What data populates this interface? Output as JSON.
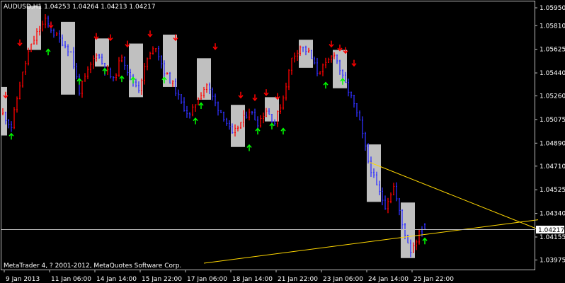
{
  "window": {
    "header": "AUDUSD,H1  1.04253 1.04264 1.04213 1.04217",
    "footer": "MetaTrader 4, ? 2001-2012, MetaQuotes Software Corp."
  },
  "colors": {
    "background": "#000000",
    "axis": "#c0c0c0",
    "bull": "#ff0000",
    "bear": "#3030ff",
    "box": "#c0c0c0",
    "arrow_up": "#00ff00",
    "arrow_down": "#ff0000",
    "trendline": "#ffd700",
    "price_line": "#c0c0c0"
  },
  "chart_data": {
    "type": "candlestick",
    "symbol": "AUDUSD",
    "timeframe": "H1",
    "ohlc": {
      "open": 1.04253,
      "high": 1.04264,
      "low": 1.04213,
      "close": 1.04217
    },
    "current_price": 1.04217,
    "ylim": [
      1.039,
      1.06
    ],
    "yticks": [
      1.0595,
      1.0581,
      1.05625,
      1.0544,
      1.0526,
      1.05075,
      1.0489,
      1.0471,
      1.04525,
      1.0434,
      1.04155,
      1.03975
    ],
    "ytick_labels": [
      "1.05950",
      "1.05810",
      "1.05625",
      "1.05440",
      "1.05260",
      "1.05075",
      "1.04890",
      "1.04710",
      "1.04525",
      "1.04340",
      "1.04155",
      "1.03975"
    ],
    "xlabels": [
      "9 Jan 2013",
      "11 Jan 06:00",
      "14 Jan 14:00",
      "15 Jan 22:00",
      "17 Jan 06:00",
      "18 Jan 14:00",
      "21 Jan 22:00",
      "23 Jan 06:00",
      "24 Jan 14:00",
      "25 Jan 22:00"
    ],
    "bar_count": 150,
    "close_path": [
      [
        0,
        1.0512
      ],
      [
        3,
        1.0502
      ],
      [
        6,
        1.0535
      ],
      [
        9,
        1.056
      ],
      [
        12,
        1.0575
      ],
      [
        15,
        1.0585
      ],
      [
        18,
        1.0575
      ],
      [
        21,
        1.0568
      ],
      [
        24,
        1.056
      ],
      [
        27,
        1.053
      ],
      [
        30,
        1.0545
      ],
      [
        33,
        1.056
      ],
      [
        36,
        1.0548
      ],
      [
        39,
        1.0538
      ],
      [
        42,
        1.0558
      ],
      [
        45,
        1.054
      ],
      [
        48,
        1.0532
      ],
      [
        51,
        1.0555
      ],
      [
        54,
        1.0565
      ],
      [
        57,
        1.0545
      ],
      [
        60,
        1.0535
      ],
      [
        63,
        1.052
      ],
      [
        66,
        1.051
      ],
      [
        69,
        1.0525
      ],
      [
        72,
        1.0535
      ],
      [
        75,
        1.052
      ],
      [
        78,
        1.051
      ],
      [
        81,
        1.0495
      ],
      [
        84,
        1.0505
      ],
      [
        87,
        1.0515
      ],
      [
        90,
        1.0505
      ],
      [
        93,
        1.0515
      ],
      [
        96,
        1.0505
      ],
      [
        99,
        1.0525
      ],
      [
        102,
        1.0555
      ],
      [
        105,
        1.0565
      ],
      [
        108,
        1.056
      ],
      [
        111,
        1.0545
      ],
      [
        114,
        1.055
      ],
      [
        117,
        1.056
      ],
      [
        120,
        1.054
      ],
      [
        123,
        1.0525
      ],
      [
        126,
        1.0505
      ],
      [
        129,
        1.0475
      ],
      [
        132,
        1.0455
      ],
      [
        135,
        1.044
      ],
      [
        138,
        1.0455
      ],
      [
        141,
        1.0425
      ],
      [
        144,
        1.0405
      ],
      [
        147,
        1.0418
      ],
      [
        149,
        1.04217
      ]
    ],
    "boxes": [
      {
        "bars": [
          -1,
          1
        ],
        "high": 1.0533,
        "low": 1.0495
      },
      {
        "bars": [
          9,
          13
        ],
        "high": 1.05965,
        "low": 1.0562
      },
      {
        "bars": [
          21,
          25
        ],
        "high": 1.0584,
        "low": 1.0527
      },
      {
        "bars": [
          33,
          37
        ],
        "high": 1.0571,
        "low": 1.0549
      },
      {
        "bars": [
          45,
          49
        ],
        "high": 1.0567,
        "low": 1.0525
      },
      {
        "bars": [
          57,
          61
        ],
        "high": 1.0574,
        "low": 1.0533
      },
      {
        "bars": [
          69,
          73
        ],
        "high": 1.05555,
        "low": 1.0523
      },
      {
        "bars": [
          81,
          85
        ],
        "high": 1.0519,
        "low": 1.0486
      },
      {
        "bars": [
          93,
          97
        ],
        "high": 1.0525,
        "low": 1.0506
      },
      {
        "bars": [
          105,
          109
        ],
        "high": 1.057,
        "low": 1.0548
      },
      {
        "bars": [
          117,
          121
        ],
        "high": 1.0562,
        "low": 1.0532
      },
      {
        "bars": [
          129,
          133
        ],
        "high": 1.0488,
        "low": 1.0443
      },
      {
        "bars": [
          141,
          145
        ],
        "high": 1.04425,
        "low": 1.0399
      }
    ],
    "arrows": [
      {
        "bar": 1,
        "price": 1.0527,
        "dir": "down"
      },
      {
        "bar": 3,
        "price": 1.0494,
        "dir": "up"
      },
      {
        "bar": 6,
        "price": 1.0568,
        "dir": "down"
      },
      {
        "bar": 16,
        "price": 1.056,
        "dir": "up"
      },
      {
        "bar": 17,
        "price": 1.0582,
        "dir": "down"
      },
      {
        "bar": 27,
        "price": 1.0537,
        "dir": "up"
      },
      {
        "bar": 33,
        "price": 1.0573,
        "dir": "down"
      },
      {
        "bar": 36,
        "price": 1.0545,
        "dir": "up"
      },
      {
        "bar": 38,
        "price": 1.0572,
        "dir": "down"
      },
      {
        "bar": 42,
        "price": 1.0539,
        "dir": "up"
      },
      {
        "bar": 44,
        "price": 1.0567,
        "dir": "down"
      },
      {
        "bar": 46,
        "price": 1.0538,
        "dir": "up"
      },
      {
        "bar": 52,
        "price": 1.0575,
        "dir": "down"
      },
      {
        "bar": 57,
        "price": 1.0538,
        "dir": "up"
      },
      {
        "bar": 61,
        "price": 1.0572,
        "dir": "down"
      },
      {
        "bar": 68,
        "price": 1.0506,
        "dir": "up"
      },
      {
        "bar": 70,
        "price": 1.0518,
        "dir": "up"
      },
      {
        "bar": 75,
        "price": 1.0565,
        "dir": "down"
      },
      {
        "bar": 84,
        "price": 1.0527,
        "dir": "down"
      },
      {
        "bar": 87,
        "price": 1.0485,
        "dir": "up"
      },
      {
        "bar": 89,
        "price": 1.0525,
        "dir": "down"
      },
      {
        "bar": 90,
        "price": 1.0498,
        "dir": "up"
      },
      {
        "bar": 93,
        "price": 1.0529,
        "dir": "down"
      },
      {
        "bar": 95,
        "price": 1.0502,
        "dir": "up"
      },
      {
        "bar": 97,
        "price": 1.0526,
        "dir": "down"
      },
      {
        "bar": 99,
        "price": 1.0498,
        "dir": "up"
      },
      {
        "bar": 114,
        "price": 1.0534,
        "dir": "up"
      },
      {
        "bar": 116,
        "price": 1.0567,
        "dir": "down"
      },
      {
        "bar": 119,
        "price": 1.0564,
        "dir": "down"
      },
      {
        "bar": 120,
        "price": 1.0537,
        "dir": "up"
      },
      {
        "bar": 121,
        "price": 1.0562,
        "dir": "down"
      },
      {
        "bar": 124,
        "price": 1.0552,
        "dir": "down"
      },
      {
        "bar": 149,
        "price": 1.0412,
        "dir": "up"
      }
    ],
    "trendlines": [
      {
        "from": [
          129.5,
          1.0474
        ],
        "to": [
          189,
          1.04215
        ]
      },
      {
        "from": [
          71,
          1.0395
        ],
        "to": [
          189,
          1.0429
        ]
      }
    ]
  }
}
